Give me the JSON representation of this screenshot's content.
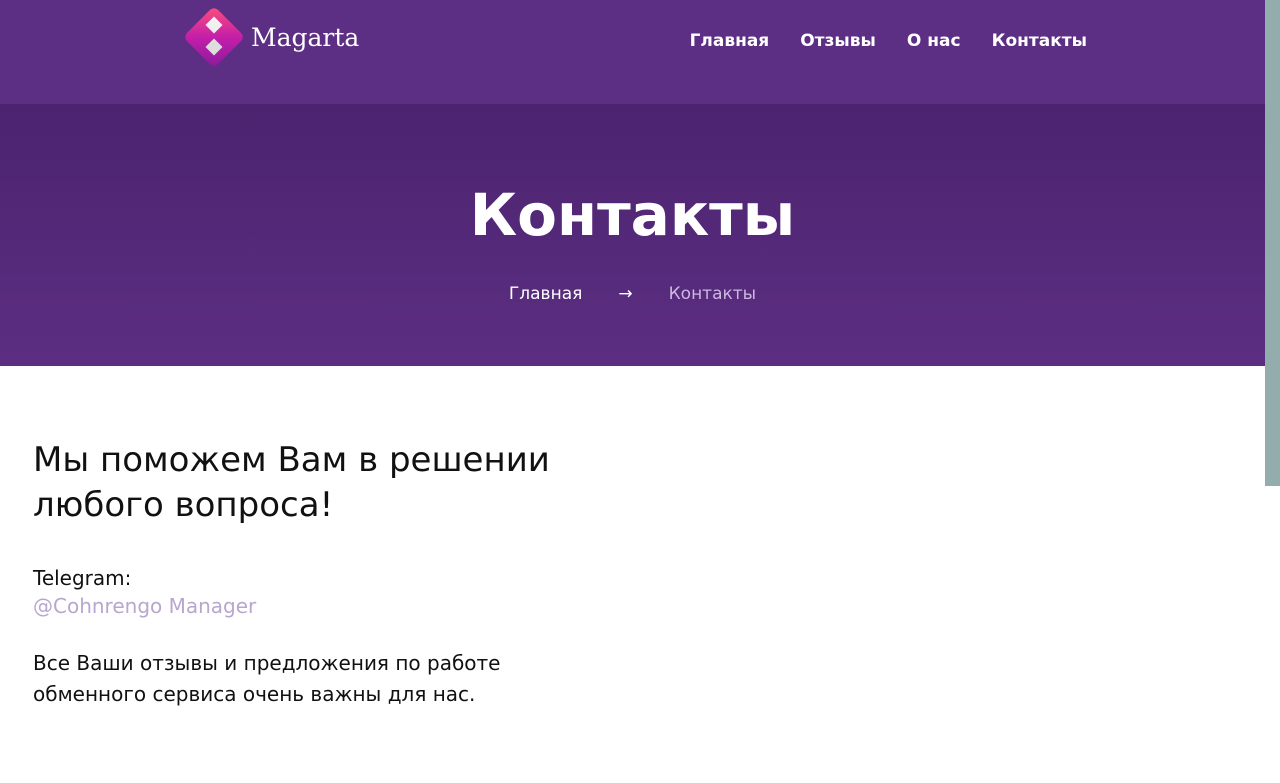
{
  "brand": {
    "name": "Magarta"
  },
  "nav": [
    "Главная",
    "Отзывы",
    "О нас",
    "Контакты"
  ],
  "hero": {
    "title": "Контакты",
    "breadcrumb": {
      "home": "Главная",
      "separator": "→",
      "current": "Контакты"
    }
  },
  "content": {
    "heading": "Мы поможем Вам в решении любого вопроса!",
    "telegram_label": "Telegram:",
    "telegram_handle": "@Cohnrengo Manager",
    "note": "Все Ваши отзывы и предложения по работе обменного сервиса очень важны для нас."
  },
  "colors": {
    "header": "#5c2f84",
    "link": "#b9a6cf",
    "scrollbar": "#93adac"
  }
}
